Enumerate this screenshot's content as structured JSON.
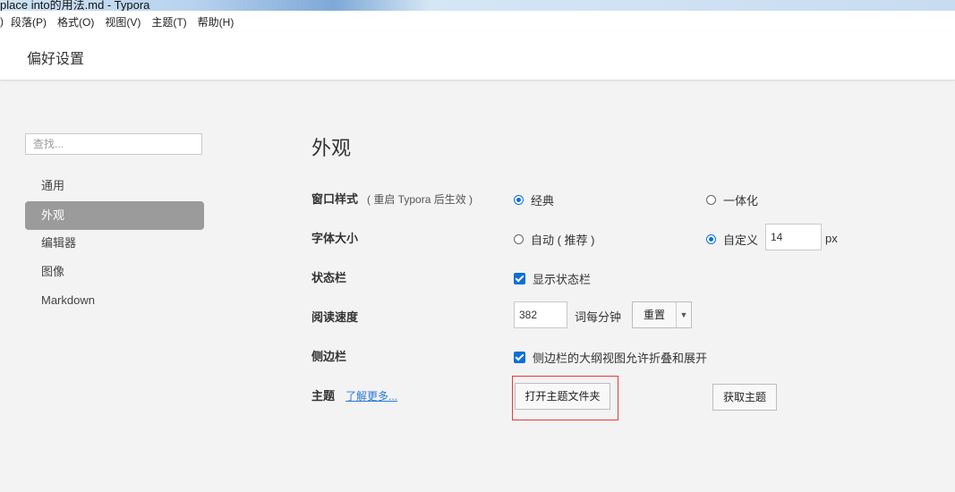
{
  "window": {
    "title": "place into的用法.md - Typora"
  },
  "menubar": [
    {
      "label": ")"
    },
    {
      "label": "段落(P)"
    },
    {
      "label": "格式(O)"
    },
    {
      "label": "视图(V)"
    },
    {
      "label": "主题(T)"
    },
    {
      "label": "帮助(H)"
    }
  ],
  "header": {
    "title": "偏好设置"
  },
  "sidebar": {
    "search_placeholder": "查找...",
    "items": [
      {
        "label": "通用"
      },
      {
        "label": "外观"
      },
      {
        "label": "编辑器"
      },
      {
        "label": "图像"
      },
      {
        "label": "Markdown"
      }
    ],
    "active_index": 1
  },
  "main": {
    "title": "外观",
    "window_style": {
      "label": "窗口样式",
      "hint": "( 重启 Typora 后生效 )",
      "options": [
        {
          "label": "经典",
          "selected": true
        },
        {
          "label": "一体化",
          "selected": false
        }
      ]
    },
    "font_size": {
      "label": "字体大小",
      "options": [
        {
          "label": "自动 ( 推荐 )",
          "selected": false
        },
        {
          "label": "自定义",
          "selected": true
        }
      ],
      "value": "14",
      "unit": "px"
    },
    "status_bar": {
      "label": "状态栏",
      "checkbox_label": "显示状态栏",
      "checked": true
    },
    "reading_speed": {
      "label": "阅读速度",
      "value": "382",
      "unit": "词每分钟",
      "reset_label": "重置",
      "dropdown_arrow": "▼"
    },
    "sidebar_setting": {
      "label": "侧边栏",
      "checkbox_label": "侧边栏的大纲视图允许折叠和展开",
      "checked": true
    },
    "theme": {
      "label": "主题",
      "link_label": "了解更多...",
      "open_folder_label": "打开主题文件夹",
      "get_themes_label": "获取主题"
    }
  },
  "colors": {
    "accent": "#0b6fd8",
    "active_nav_bg": "#9b9b9b",
    "highlight_border": "#e23a3a",
    "link": "#2a7ad4",
    "page_bg": "#f3f3f3"
  }
}
